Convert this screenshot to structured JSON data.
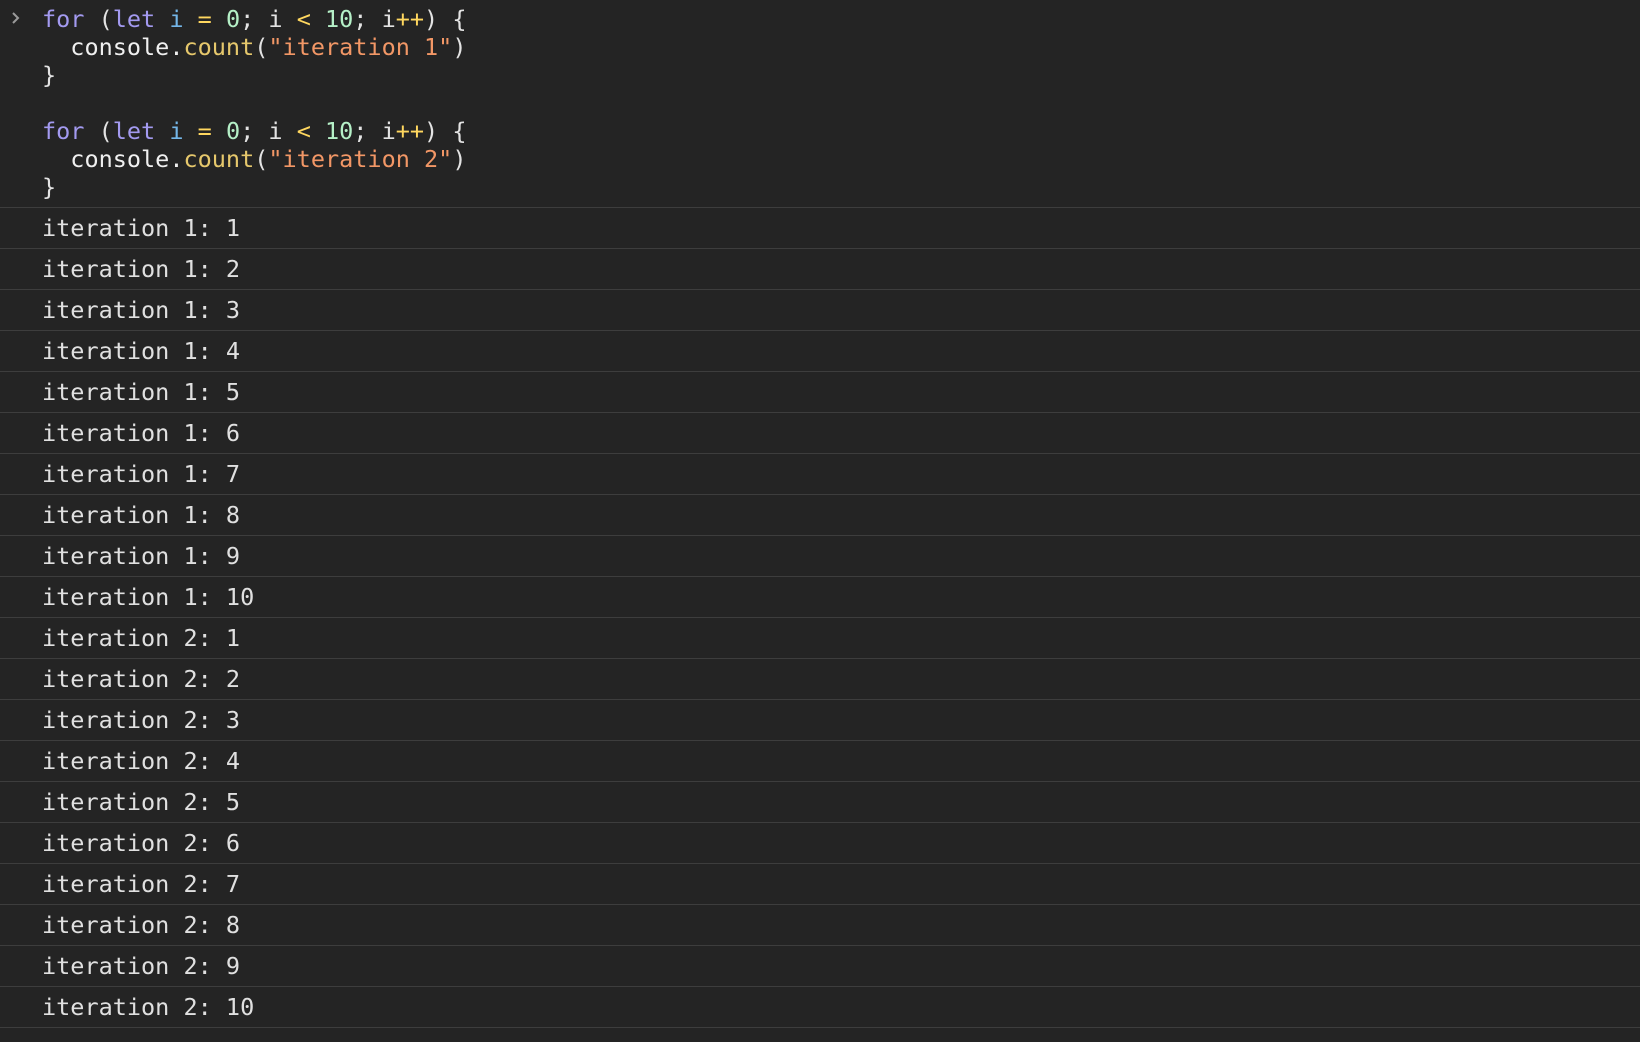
{
  "console": {
    "prompt_icon": "chevron-right-icon",
    "input": {
      "block1": {
        "kw_for": "for",
        "paren_open": " (",
        "kw_let": "let",
        "var_i": " i",
        "eq": " =",
        "zero": " 0",
        "semi1": "; i ",
        "lt": "<",
        "ten": " 10",
        "semi2": "; i",
        "inc": "++",
        "close": ") {",
        "indent_console": "  console.",
        "fn_count": "count",
        "call_open": "(",
        "str": "\"iteration 1\"",
        "call_close": ")",
        "brace_close": "}"
      },
      "block2": {
        "kw_for": "for",
        "paren_open": " (",
        "kw_let": "let",
        "var_i": " i",
        "eq": " =",
        "zero": " 0",
        "semi1": "; i ",
        "lt": "<",
        "ten": " 10",
        "semi2": "; i",
        "inc": "++",
        "close": ") {",
        "indent_console": "  console.",
        "fn_count": "count",
        "call_open": "(",
        "str": "\"iteration 2\"",
        "call_close": ")",
        "brace_close": "}"
      }
    },
    "output": [
      "iteration 1: 1",
      "iteration 1: 2",
      "iteration 1: 3",
      "iteration 1: 4",
      "iteration 1: 5",
      "iteration 1: 6",
      "iteration 1: 7",
      "iteration 1: 8",
      "iteration 1: 9",
      "iteration 1: 10",
      "iteration 2: 1",
      "iteration 2: 2",
      "iteration 2: 3",
      "iteration 2: 4",
      "iteration 2: 5",
      "iteration 2: 6",
      "iteration 2: 7",
      "iteration 2: 8",
      "iteration 2: 9",
      "iteration 2: 10"
    ]
  }
}
